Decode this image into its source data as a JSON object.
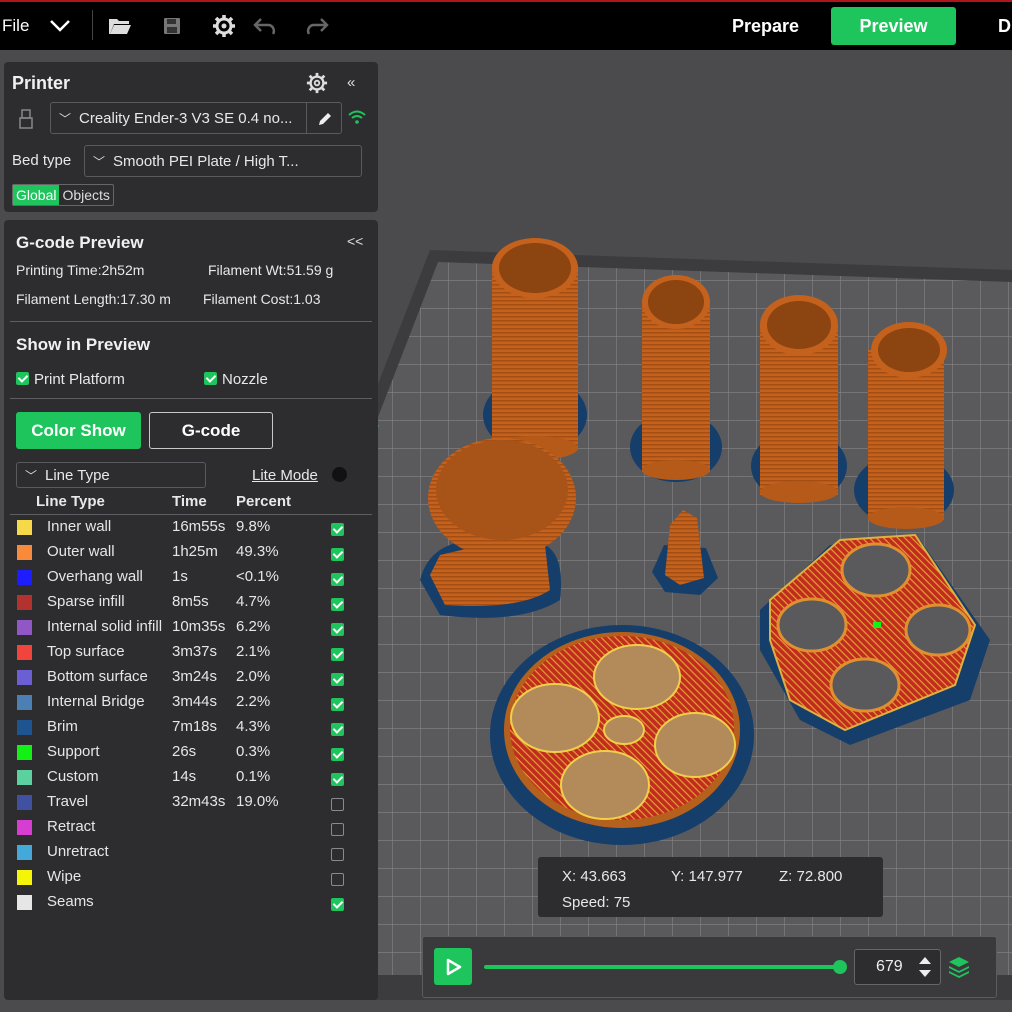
{
  "topbar": {
    "file_label": "File",
    "prepare_label": "Prepare",
    "preview_label": "Preview",
    "device_label_partial": "D"
  },
  "printer": {
    "title": "Printer",
    "printer_name": "Creality Ender-3 V3 SE 0.4 no...",
    "bed_type_label": "Bed type",
    "bed_type_value": "Smooth PEI Plate / High T...",
    "tabs": [
      "Global",
      "Objects"
    ]
  },
  "gcode": {
    "title": "G-code Preview",
    "collapse": "<<",
    "printing_time": "Printing Time:2h52m",
    "filament_wt": "Filament Wt:51.59 g",
    "filament_length": "Filament Length:17.30 m",
    "filament_cost": "Filament Cost:1.03",
    "show_title": "Show in Preview",
    "print_platform": "Print Platform",
    "nozzle": "Nozzle",
    "color_show": "Color Show",
    "gcode_btn": "G-code",
    "view_type": "Line Type",
    "lite_mode": "Lite Mode",
    "headers": {
      "type": "Line Type",
      "time": "Time",
      "percent": "Percent"
    }
  },
  "legend": [
    {
      "name": "Inner wall",
      "time": "16m55s",
      "percent": "9.8%",
      "color": "#f5d949",
      "checked": true
    },
    {
      "name": "Outer wall",
      "time": "1h25m",
      "percent": "49.3%",
      "color": "#f88a3b",
      "checked": true
    },
    {
      "name": "Overhang wall",
      "time": "1s",
      "percent": "<0.1%",
      "color": "#1d1dff",
      "checked": true
    },
    {
      "name": "Sparse infill",
      "time": "8m5s",
      "percent": "4.7%",
      "color": "#b3312e",
      "checked": true
    },
    {
      "name": "Internal solid infill",
      "time": "10m35s",
      "percent": "6.2%",
      "color": "#9257c7",
      "checked": true
    },
    {
      "name": "Top surface",
      "time": "3m37s",
      "percent": "2.1%",
      "color": "#f1443c",
      "checked": true
    },
    {
      "name": "Bottom surface",
      "time": "3m24s",
      "percent": "2.0%",
      "color": "#6b5fd3",
      "checked": true
    },
    {
      "name": "Internal Bridge",
      "time": "3m44s",
      "percent": "2.2%",
      "color": "#4c80b4",
      "checked": true
    },
    {
      "name": "Brim",
      "time": "7m18s",
      "percent": "4.3%",
      "color": "#1e5490",
      "checked": true
    },
    {
      "name": "Support",
      "time": "26s",
      "percent": "0.3%",
      "color": "#13f013",
      "checked": true
    },
    {
      "name": "Custom",
      "time": "14s",
      "percent": "0.1%",
      "color": "#5cd1a0",
      "checked": true
    },
    {
      "name": "Travel",
      "time": "32m43s",
      "percent": "19.0%",
      "color": "#3f51a0",
      "checked": false
    },
    {
      "name": "Retract",
      "time": "",
      "percent": "",
      "color": "#d53ed0",
      "checked": false
    },
    {
      "name": "Unretract",
      "time": "",
      "percent": "",
      "color": "#44a8d8",
      "checked": false
    },
    {
      "name": "Wipe",
      "time": "",
      "percent": "",
      "color": "#f5f50a",
      "checked": false
    },
    {
      "name": "Seams",
      "time": "",
      "percent": "",
      "color": "#e6e6e6",
      "checked": true
    }
  ],
  "coords": {
    "x": "X: 43.663",
    "y": "Y: 147.977",
    "z": "Z: 72.800",
    "speed": "Speed: 75"
  },
  "slider": {
    "layer": "679",
    "progress": 1.0
  },
  "colors": {
    "accent": "#1ec45c",
    "panel": "#2d2d30",
    "print_orange": "#c8641c",
    "brim_blue": "#1e4a78"
  }
}
